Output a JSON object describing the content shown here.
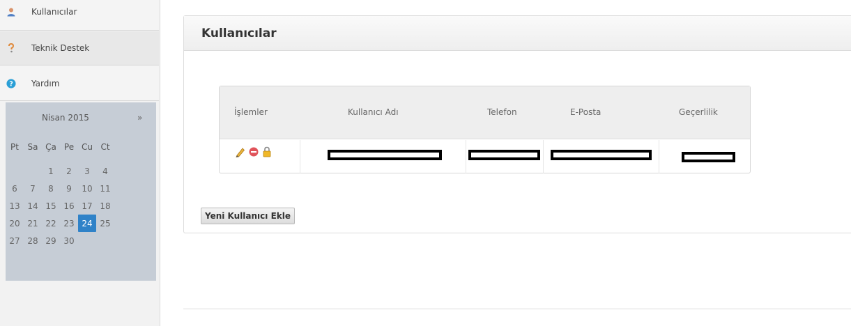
{
  "sidebar": {
    "items": [
      {
        "label": "Kullanıcılar",
        "icon": "user-icon"
      },
      {
        "label": "Teknik Destek",
        "icon": "support-icon"
      },
      {
        "label": "Yardım",
        "icon": "help-icon"
      }
    ]
  },
  "calendar": {
    "month_label": "Nisan 2015",
    "next_label": "»",
    "weekdays": [
      "Pt",
      "Sa",
      "Ça",
      "Pe",
      "Cu",
      "Ct"
    ],
    "weeks": [
      [
        "",
        "",
        "1",
        "2",
        "3",
        "4"
      ],
      [
        "6",
        "7",
        "8",
        "9",
        "10",
        "11"
      ],
      [
        "13",
        "14",
        "15",
        "16",
        "17",
        "18"
      ],
      [
        "20",
        "21",
        "22",
        "23",
        "24",
        "25"
      ],
      [
        "27",
        "28",
        "29",
        "30",
        "",
        ""
      ]
    ],
    "selected_day": "24",
    "selected_color": "#2f82c8"
  },
  "main": {
    "title": "Kullanıcılar",
    "table": {
      "columns": [
        "İşlemler",
        "Kullanıcı Adı",
        "Telefon",
        "E-Posta",
        "Geçerlilik"
      ],
      "row_actions": [
        "edit-icon",
        "delete-icon",
        "lock-icon"
      ]
    },
    "add_button_label": "Yeni Kullanıcı Ekle"
  }
}
